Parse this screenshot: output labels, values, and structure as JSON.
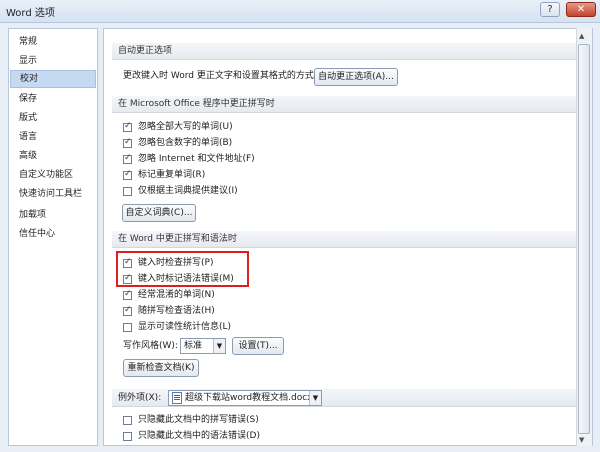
{
  "window": {
    "title": "Word 选项",
    "help": "?",
    "close": "✕"
  },
  "sidebar": {
    "items": [
      {
        "label": "常规"
      },
      {
        "label": "显示"
      },
      {
        "label": "校对",
        "selected": true
      },
      {
        "label": "保存"
      },
      {
        "label": "版式"
      },
      {
        "label": "语言"
      },
      {
        "label": "高级"
      },
      {
        "label": "自定义功能区"
      },
      {
        "label": "快速访问工具栏"
      },
      {
        "label": "加载项"
      },
      {
        "label": "信任中心"
      }
    ]
  },
  "autocorrect": {
    "header": "自动更正选项",
    "desc": "更改键入时 Word 更正文字和设置其格式的方式:",
    "button": "自动更正选项(A)..."
  },
  "office_spell": {
    "header": "在 Microsoft Office 程序中更正拼写时",
    "options": [
      {
        "label": "忽略全部大写的单词(U)",
        "checked": true
      },
      {
        "label": "忽略包含数字的单词(B)",
        "checked": true
      },
      {
        "label": "忽略 Internet 和文件地址(F)",
        "checked": true
      },
      {
        "label": "标记重复单词(R)",
        "checked": true
      },
      {
        "label": "仅根据主词典提供建议(I)",
        "checked": false
      }
    ],
    "custom_dict_button": "自定义词典(C)..."
  },
  "word_spell": {
    "header": "在 Word 中更正拼写和语法时",
    "options": [
      {
        "label": "键入时检查拼写(P)",
        "checked": true
      },
      {
        "label": "键入时标记语法错误(M)",
        "checked": true
      },
      {
        "label": "经常混淆的单词(N)",
        "checked": true
      },
      {
        "label": "随拼写检查语法(H)",
        "checked": true
      },
      {
        "label": "显示可读性统计信息(L)",
        "checked": false
      }
    ],
    "style_label": "写作风格(W):",
    "style_value": "标准",
    "settings_button": "设置(T)...",
    "recheck_button": "重新检查文档(K)"
  },
  "exceptions": {
    "label": "例外项(X):",
    "document": "超级下载站word教程文档.docx",
    "options": [
      {
        "label": "只隐藏此文档中的拼写错误(S)",
        "checked": false
      },
      {
        "label": "只隐藏此文档中的语法错误(D)",
        "checked": false
      }
    ]
  },
  "highlight_color": "#d9201a"
}
